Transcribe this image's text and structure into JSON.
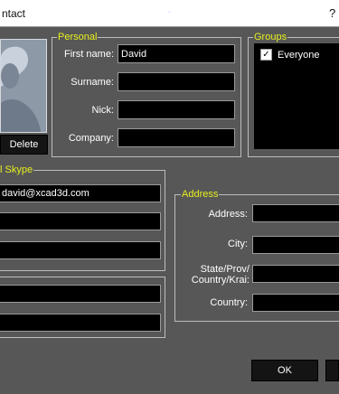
{
  "window": {
    "title": "ntact",
    "title_mark": "¨",
    "help": "?"
  },
  "photo": {
    "delete_label": "Delete"
  },
  "personal": {
    "legend": "Personal",
    "first_name_label": "First name:",
    "first_name_value": "David",
    "surname_label": "Surname:",
    "surname_value": "",
    "nick_label": "Nick:",
    "nick_value": "",
    "company_label": "Company:",
    "company_value": ""
  },
  "groups": {
    "legend": "Groups",
    "items": [
      {
        "label": "Everyone",
        "checked": true
      }
    ]
  },
  "skype": {
    "legend": "l Skype",
    "email_value": "david@xcad3d.com",
    "field2_value": "",
    "field3_value": ""
  },
  "other": {
    "field1_value": "",
    "field2_value": ""
  },
  "address": {
    "legend": "Address",
    "address_label": "Address:",
    "city_label": "City:",
    "state_label_line1": "State/Prov/",
    "state_label_line2": "Country/Krai:",
    "country_label": "Country:",
    "address_value": "",
    "city_value": "",
    "state_value": "",
    "country_value": ""
  },
  "buttons": {
    "ok_label": "OK"
  }
}
